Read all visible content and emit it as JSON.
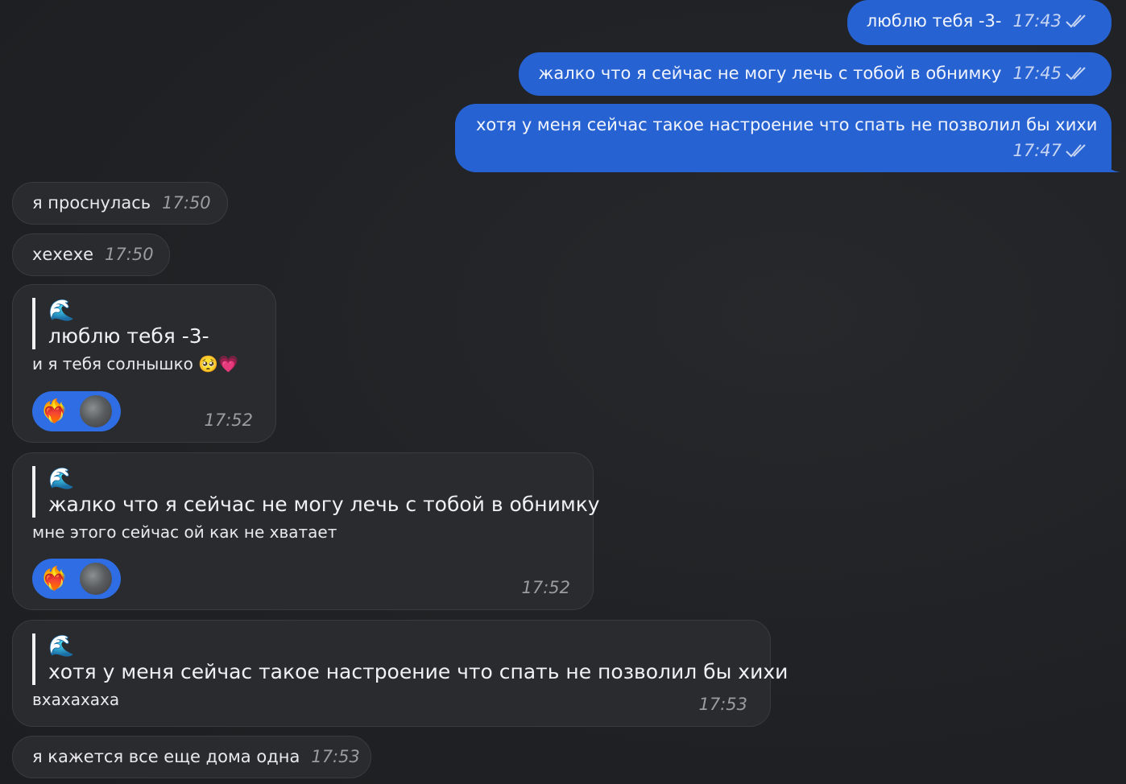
{
  "messages": [
    {
      "text": "люблю тебя -3-",
      "time": "17:43"
    },
    {
      "text": "жалко что я сейчас не могу лечь с тобой в обнимку",
      "time": "17:45"
    },
    {
      "text": "хотя у меня сейчас такое настроение что спать не позволил бы хихи",
      "time": "17:47"
    },
    {
      "text": "я проснулась",
      "time": "17:50"
    },
    {
      "text": "хехехе",
      "time": "17:50"
    },
    {
      "quote_icon": "🌊",
      "quote_text": "люблю тебя -3-",
      "text": "и я тебя солнышко",
      "emojis": "🥺💗",
      "reaction": "❤️‍🔥",
      "time": "17:52"
    },
    {
      "quote_icon": "🌊",
      "quote_text": "жалко что я сейчас не могу лечь с тобой в обнимку",
      "text": "мне этого сейчас ой как не хватает",
      "reaction": "❤️‍🔥",
      "time": "17:52"
    },
    {
      "quote_icon": "🌊",
      "quote_text": "хотя у меня сейчас такое настроение что спать не позволил бы хихи",
      "text": "вхахахаха",
      "time": "17:53"
    },
    {
      "text": "я кажется все еще дома одна",
      "time": "17:53"
    }
  ],
  "colors": {
    "background": "#1f2124",
    "outgoing": "#2762d3",
    "incoming": "#2a2b2e",
    "reaction": "#2e6de3"
  },
  "icons": {
    "read_ticks": "double-check-icon",
    "quote_avatar": "wave-icon",
    "reaction_avatar": "avatar"
  }
}
